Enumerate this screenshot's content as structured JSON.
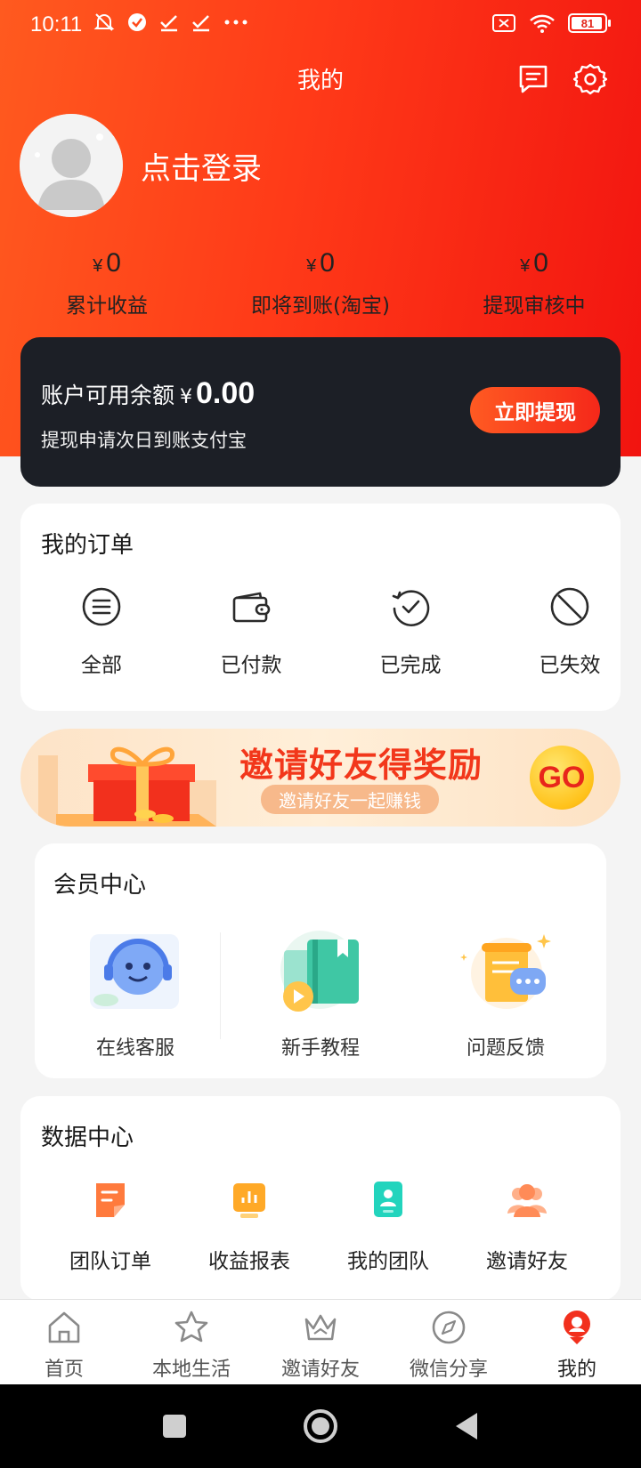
{
  "status_bar": {
    "time": "10:11",
    "battery": "81"
  },
  "header": {
    "title": "我的"
  },
  "profile": {
    "login_label": "点击登录"
  },
  "stats": [
    {
      "currency": "¥",
      "amount": "0",
      "label": "累计收益"
    },
    {
      "currency": "¥",
      "amount": "0",
      "label": "即将到账(淘宝)"
    },
    {
      "currency": "¥",
      "amount": "0",
      "label": "提现审核中"
    }
  ],
  "balance": {
    "label": "账户可用余额",
    "currency": "¥",
    "amount": "0.00",
    "note": "提现申请次日到账支付宝",
    "button_label": "立即提现"
  },
  "orders": {
    "title": "我的订单",
    "items": [
      {
        "label": "全部",
        "icon": "list-icon"
      },
      {
        "label": "已付款",
        "icon": "wallet-icon"
      },
      {
        "label": "已完成",
        "icon": "check-circle-icon"
      },
      {
        "label": "已失效",
        "icon": "ban-icon"
      }
    ]
  },
  "banner": {
    "title": "邀请好友得奖励",
    "subtitle": "邀请好友一起赚钱",
    "badge": "GO"
  },
  "member_center": {
    "title": "会员中心",
    "items": [
      {
        "label": "在线客服",
        "icon": "customer-service-icon"
      },
      {
        "label": "新手教程",
        "icon": "tutorial-book-icon"
      },
      {
        "label": "问题反馈",
        "icon": "feedback-icon"
      }
    ]
  },
  "data_center": {
    "title": "数据中心",
    "items": [
      {
        "label": "团队订单",
        "icon": "team-order-icon",
        "color": "#ff7a3d"
      },
      {
        "label": "收益报表",
        "icon": "revenue-report-icon",
        "color": "#ffa927"
      },
      {
        "label": "我的团队",
        "icon": "my-team-icon",
        "color": "#22d4bd"
      },
      {
        "label": "邀请好友",
        "icon": "invite-friends-icon",
        "color": "#ff8b57"
      }
    ]
  },
  "tabs": [
    {
      "label": "首页",
      "icon": "home-icon"
    },
    {
      "label": "本地生活",
      "icon": "star-icon"
    },
    {
      "label": "邀请好友",
      "icon": "crown-icon"
    },
    {
      "label": "微信分享",
      "icon": "compass-icon"
    },
    {
      "label": "我的",
      "icon": "profile-icon",
      "active": true
    }
  ],
  "colors": {
    "accent": "#f5281a",
    "dark_card": "#1c1f26"
  }
}
